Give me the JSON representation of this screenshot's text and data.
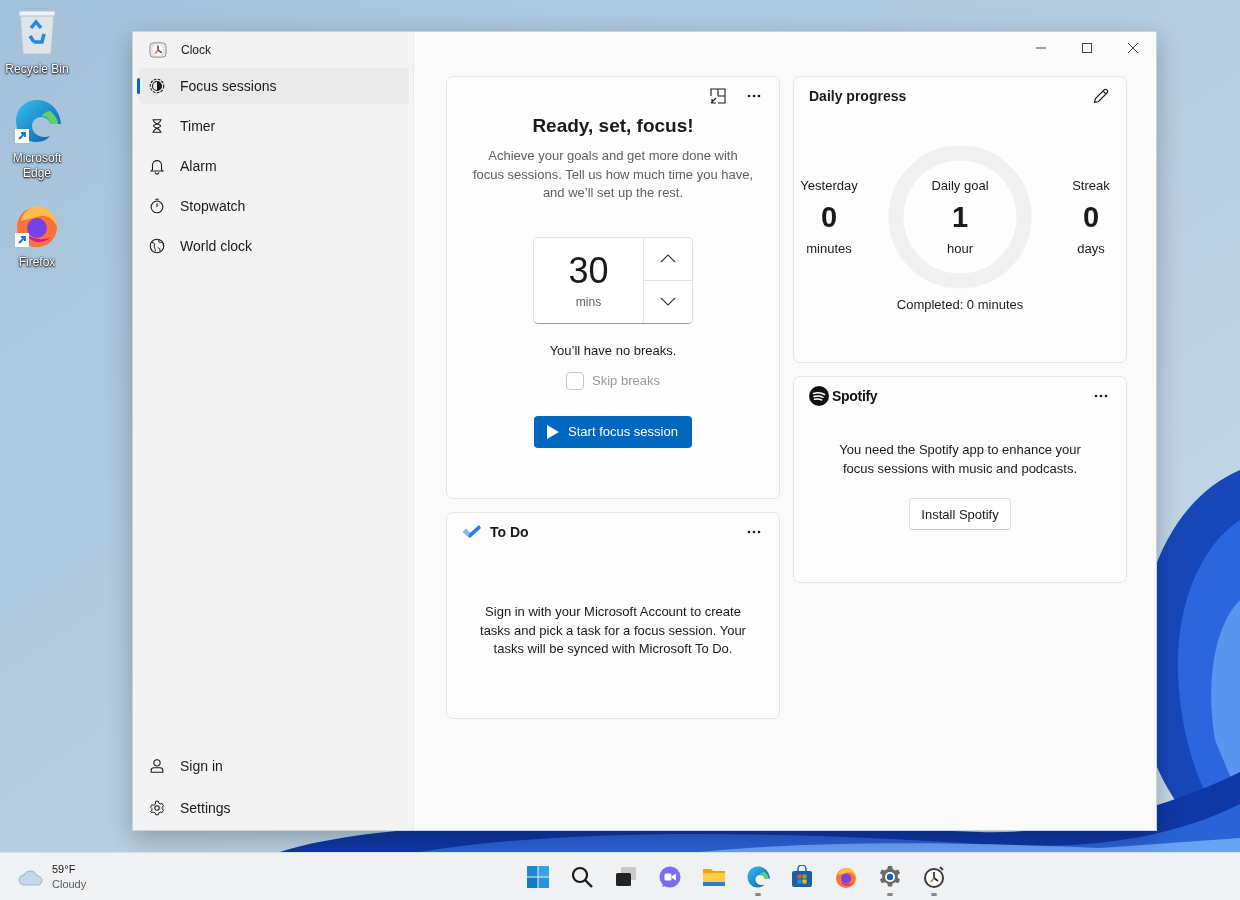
{
  "desktop_icons": [
    {
      "label": "Recycle Bin",
      "kind": "recycle",
      "shortcut": false
    },
    {
      "label": "Microsoft Edge",
      "kind": "edge",
      "shortcut": true
    },
    {
      "label": "Firefox",
      "kind": "firefox",
      "shortcut": true
    }
  ],
  "window": {
    "title": "Clock"
  },
  "sidebar": {
    "items": [
      {
        "label": "Focus sessions",
        "kind": "focus",
        "selected": true
      },
      {
        "label": "Timer",
        "kind": "timer",
        "selected": false
      },
      {
        "label": "Alarm",
        "kind": "alarm",
        "selected": false
      },
      {
        "label": "Stopwatch",
        "kind": "stopwatch",
        "selected": false
      },
      {
        "label": "World clock",
        "kind": "world",
        "selected": false
      }
    ],
    "footer_items": [
      {
        "label": "Sign in",
        "kind": "person"
      },
      {
        "label": "Settings",
        "kind": "gear"
      }
    ]
  },
  "focus_card": {
    "title": "Ready, set, focus!",
    "description": "Achieve your goals and get more done with focus sessions. Tell us how much time you have, and we’ll set up the rest.",
    "duration": "30",
    "unit": "mins",
    "breaks_note": "You’ll have no breaks.",
    "skip_breaks": {
      "label": "Skip breaks",
      "checked": false,
      "disabled": true
    },
    "start_button": "Start focus session"
  },
  "todo_card": {
    "title": "To Do",
    "message": "Sign in with your Microsoft Account to create tasks and pick a task for a focus session. Your tasks will be synced with Microsoft To Do."
  },
  "daily_progress": {
    "title": "Daily progress",
    "yesterday": {
      "label": "Yesterday",
      "value": "0",
      "unit": "minutes"
    },
    "goal": {
      "label": "Daily goal",
      "value": "1",
      "unit": "hour"
    },
    "streak": {
      "label": "Streak",
      "value": "0",
      "unit": "days"
    },
    "completed": "Completed: 0 minutes"
  },
  "spotify_card": {
    "logo_text": "Spotify",
    "message": "You need the Spotify app to enhance your focus sessions with music and podcasts.",
    "button": "Install Spotify"
  },
  "taskbar": {
    "weather": {
      "temperature": "59°F",
      "condition": "Cloudy"
    },
    "apps": [
      {
        "kind": "start",
        "running": false
      },
      {
        "kind": "search",
        "running": false
      },
      {
        "kind": "task-view",
        "running": false
      },
      {
        "kind": "chat",
        "running": false
      },
      {
        "kind": "files",
        "running": false
      },
      {
        "kind": "edge",
        "running": true
      },
      {
        "kind": "store",
        "running": false
      },
      {
        "kind": "firefox",
        "running": false
      },
      {
        "kind": "settings",
        "running": true
      },
      {
        "kind": "clock",
        "running": true
      }
    ]
  }
}
